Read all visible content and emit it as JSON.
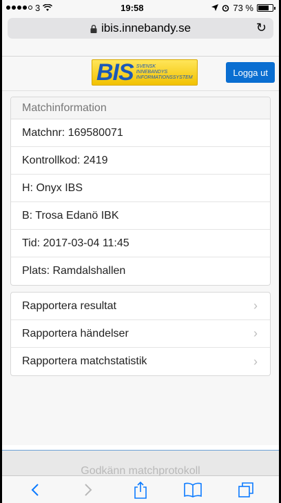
{
  "status_bar": {
    "carrier": "3",
    "time": "19:58",
    "battery": "73 %"
  },
  "browser": {
    "url": "ibis.innebandy.se"
  },
  "header": {
    "logo_big": "BIS",
    "logo_small_1": "SVENSK",
    "logo_small_2": "INNEBANDYS",
    "logo_small_3": "INFORMATIONSSYSTEM",
    "logout_label": "Logga ut"
  },
  "match_info": {
    "heading": "Matchinformation",
    "rows": [
      "Matchnr: 169580071",
      "Kontrollkod: 2419",
      "H: Onyx IBS",
      "B: Trosa Edanö IBK",
      "Tid: 2017-03-04 11:45",
      "Plats: Ramdalshallen"
    ]
  },
  "actions": {
    "items": [
      "Rapportera resultat",
      "Rapportera händelser",
      "Rapportera matchstatistik"
    ]
  },
  "approve_label": "Godkänn matchprotokoll",
  "colors": {
    "accent": "#0a6ed1",
    "logo_yellow": "#f2c200",
    "logo_blue": "#1b58b8"
  },
  "toolbar_icons": [
    "back-icon",
    "forward-icon",
    "share-icon",
    "bookmarks-icon",
    "tabs-icon"
  ]
}
